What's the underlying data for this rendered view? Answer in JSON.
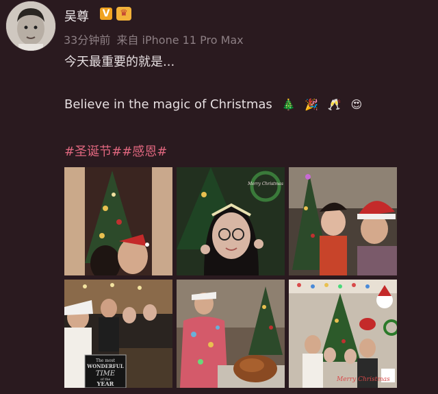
{
  "post": {
    "username": "吴尊",
    "verified_badge": "V",
    "time": "33分钟前",
    "source": "来自 iPhone 11 Pro Max",
    "text_line1": "今天最重要的就是...",
    "text_line2": "Believe in the magic of Christmas",
    "emojis": [
      "christmas-tree",
      "party-popper",
      "clinking-glasses",
      "heart-eyes"
    ],
    "tags": [
      "#圣诞节#",
      "#感恩#"
    ]
  },
  "photos": [
    {
      "name": "photo-1",
      "desc": "couple kissing by christmas tree"
    },
    {
      "name": "photo-2",
      "desc": "girl with glasses and tiara",
      "overlay_text": "Merry Christmas"
    },
    {
      "name": "photo-3",
      "desc": "children in santa hats by tree"
    },
    {
      "name": "photo-4",
      "desc": "group photo at christmas party",
      "sign_lines": [
        "The most",
        "WONDERFUL",
        "TIME",
        "of the",
        "YEAR"
      ]
    },
    {
      "name": "photo-5",
      "desc": "man carving turkey"
    },
    {
      "name": "photo-6",
      "desc": "family by christmas tree",
      "overlay_text": "Merry Christmas"
    }
  ],
  "colors": {
    "background": "#2a1a1f",
    "tag": "#e0677f",
    "meta": "#8d7f84"
  }
}
